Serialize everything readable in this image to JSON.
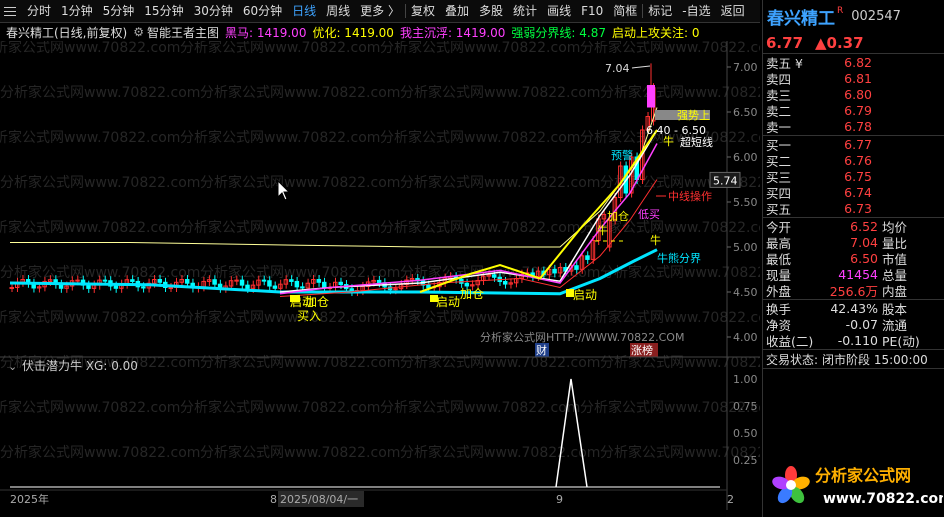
{
  "toolbar": {
    "items": [
      "分时",
      "1分钟",
      "5分钟",
      "15分钟",
      "30分钟",
      "60分钟",
      "日线",
      "周线",
      "更多 〉",
      "复权",
      "叠加",
      "多股",
      "统计",
      "画线",
      "F10",
      "简框",
      "标记",
      "-自选",
      "返回"
    ],
    "active_index": 6
  },
  "info": {
    "name": "春兴精工(日线,前复权)",
    "indicator": "智能王者主图",
    "hm_label": "黑马: 1419.00",
    "yh_label": "优化: 1419.00",
    "zz_label": "我主沉浮: 1419.00",
    "qr_label": "强弱分界线: 4.87",
    "qd_label": "启动上攻关注: 0"
  },
  "sub": {
    "title": "伏击潜力牛 XG: 0.00"
  },
  "watermark": "分析家公式网www.70822.com",
  "watermark_http": "分析家公式网HTTP://WWW.70822.COM",
  "price_axis": [
    "7.00",
    "6.50",
    "6.00",
    "5.50",
    "5.00",
    "4.50",
    "4.00"
  ],
  "sub_axis": [
    "1.00",
    "0.75",
    "0.50",
    "0.25"
  ],
  "last_price_tag": "5.74",
  "time_labels": [
    "2025年",
    "8",
    "2025/08/04/一",
    "9",
    "2"
  ],
  "event_labels": {
    "cai": "财",
    "zhangbang": "涨榜"
  },
  "annotations": {
    "high": "7.04",
    "range": "6.40 - 6.50",
    "strong": "强势上",
    "super_short": "超短线",
    "niu1": "牛",
    "yujing": "预警",
    "middle": "中线操作",
    "jiacang1": "加仓",
    "niu2": "牛",
    "dimai": "低买",
    "niu3": "牛",
    "niufen": "牛熊分界",
    "maibuy": "买入",
    "jiacang2": "加仓",
    "qidong1": "启动",
    "qidong2": "启动",
    "jiacang3": "加仓",
    "qidong3": "启动"
  },
  "chart_data": {
    "type": "candlestick",
    "ylim": [
      3.9,
      7.3
    ],
    "sub_ylim": [
      0,
      1.1
    ]
  },
  "stock": {
    "name": "春兴精工",
    "code": "002547",
    "badge": "R",
    "price": "6.77",
    "change": "▲0.37"
  },
  "asks": [
    {
      "label": "卖五 ¥",
      "price": "6.82"
    },
    {
      "label": "卖四",
      "price": "6.81"
    },
    {
      "label": "卖三",
      "price": "6.80"
    },
    {
      "label": "卖二",
      "price": "6.79"
    },
    {
      "label": "卖一",
      "price": "6.78"
    }
  ],
  "bids": [
    {
      "label": "买一",
      "price": "6.77"
    },
    {
      "label": "买二",
      "price": "6.76"
    },
    {
      "label": "买三",
      "price": "6.75"
    },
    {
      "label": "买四",
      "price": "6.74"
    },
    {
      "label": "买五",
      "price": "6.73"
    }
  ],
  "stats1": [
    {
      "l": "今开",
      "v": "6.52",
      "l2": "均价"
    },
    {
      "l": "最高",
      "v": "7.04",
      "l2": "量比"
    },
    {
      "l": "最低",
      "v": "6.50",
      "l2": "市值"
    },
    {
      "l": "现量",
      "v": "41454",
      "l2": "总量"
    },
    {
      "l": "外盘",
      "v": "256.6万",
      "l2": "内盘"
    }
  ],
  "stats2": [
    {
      "l": "换手",
      "v": "42.43%",
      "l2": "股本"
    },
    {
      "l": "净资",
      "v": "-0.07",
      "l2": "流通"
    },
    {
      "l": "收益(二)",
      "v": "-0.110",
      "l2": "PE(动)"
    }
  ],
  "status": {
    "label": "交易状态:",
    "value": "闭市阶段 15:00:00"
  },
  "logo": {
    "cn": "分析家公式网",
    "url": "www.70822.com"
  },
  "colors": {
    "up": "#ff3030",
    "down": "#00ffff",
    "yellow": "#ffff00",
    "blue": "#3ea3ff",
    "magenta": "#ff40ff"
  }
}
